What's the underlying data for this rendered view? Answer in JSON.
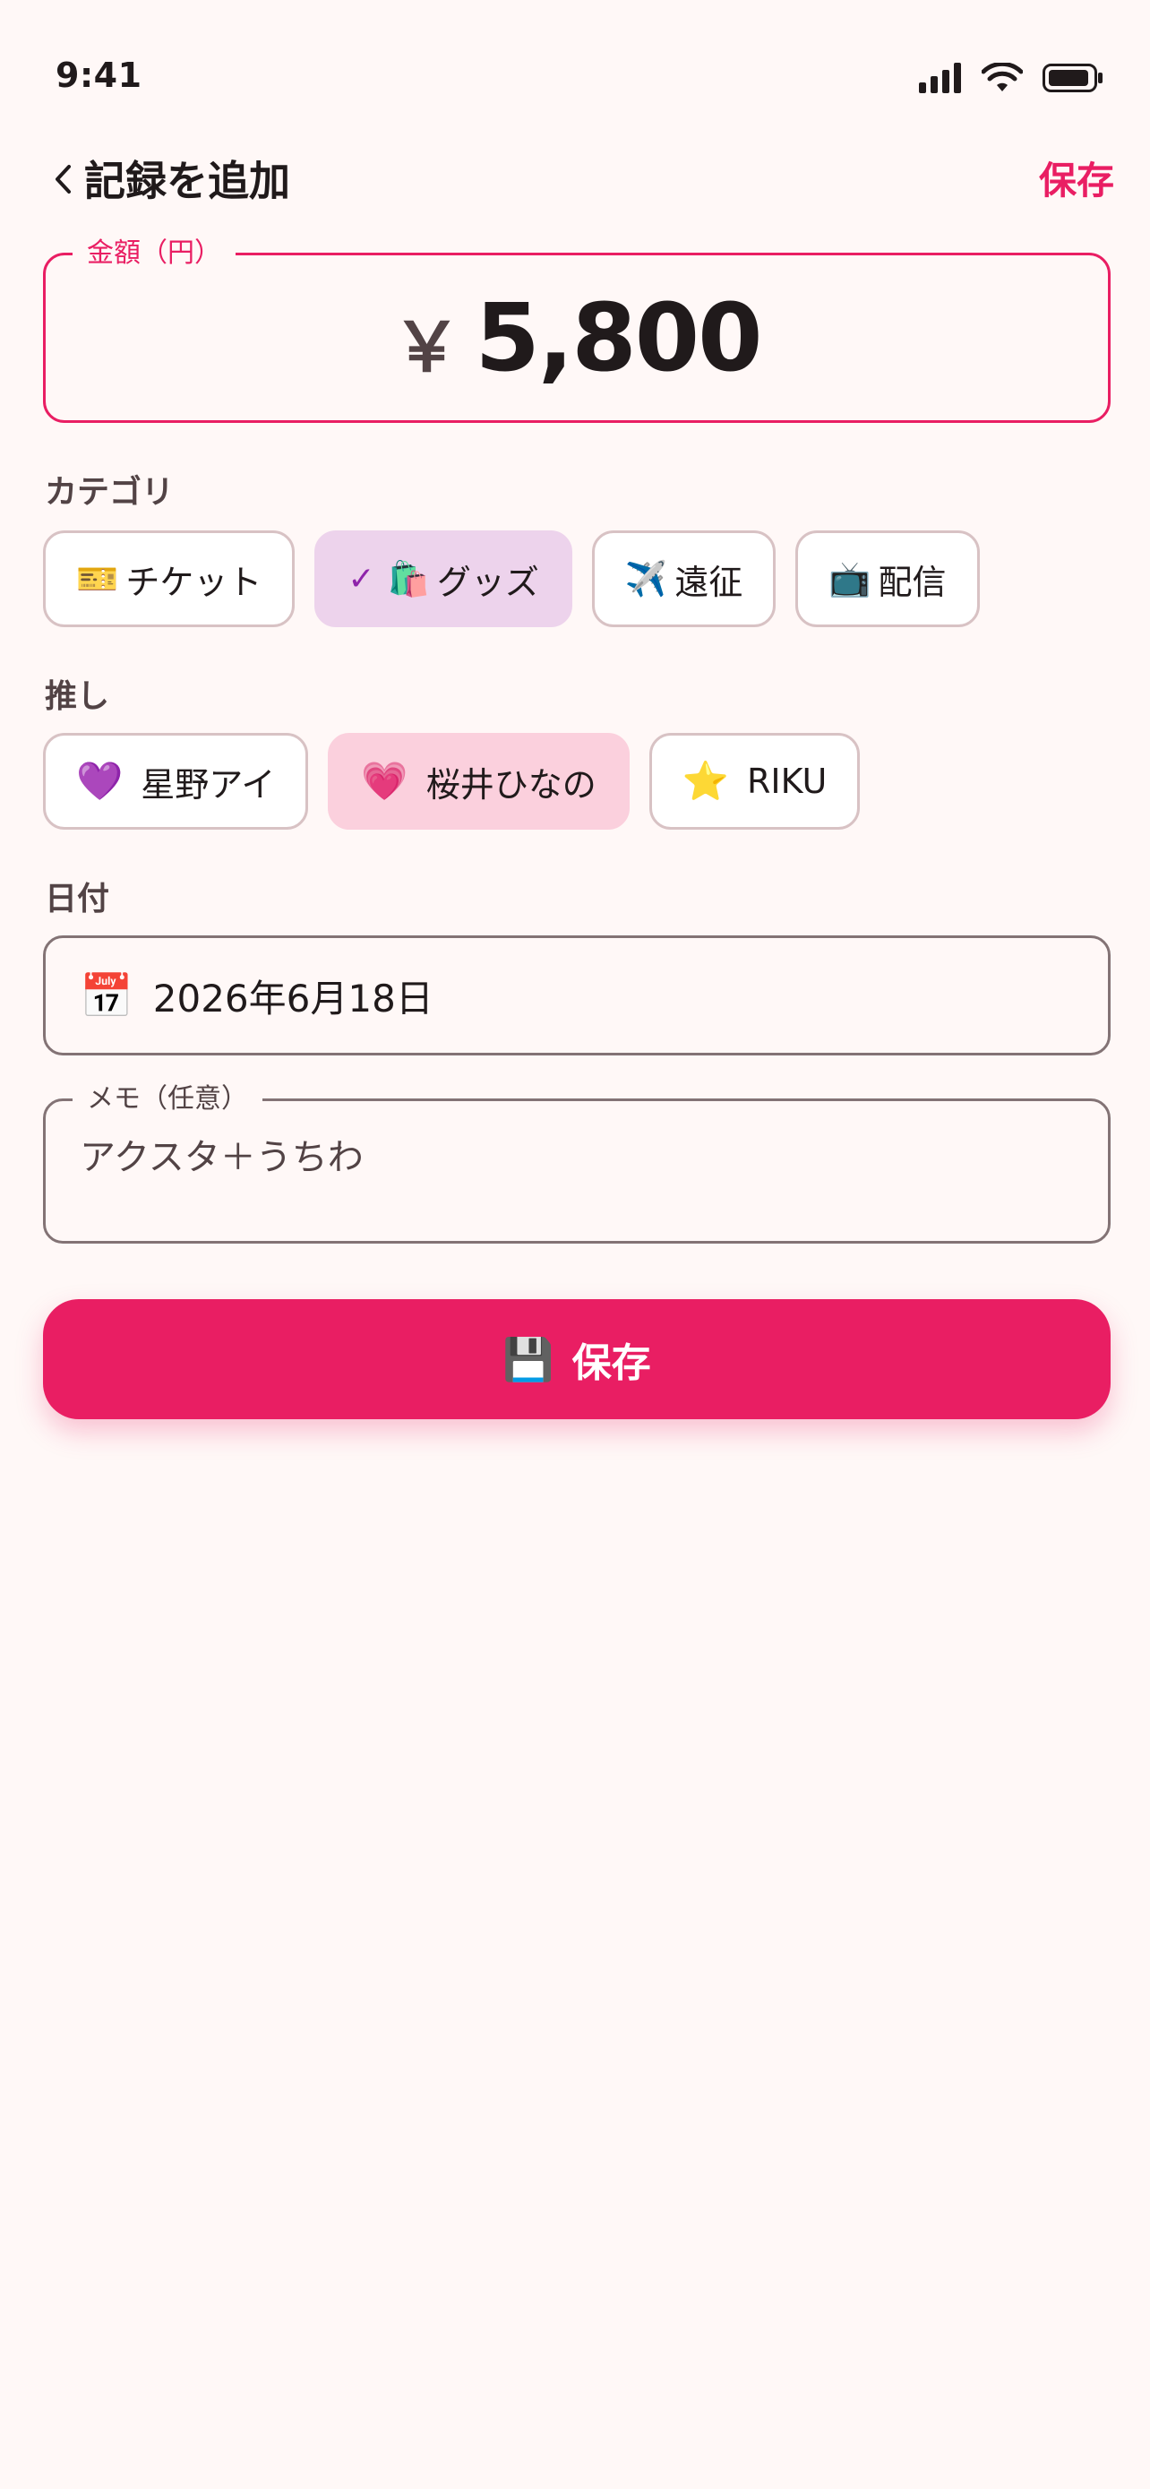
{
  "status_bar": {
    "time": "9:41"
  },
  "app_bar": {
    "title": "記録を追加",
    "save_label": "保存"
  },
  "amount": {
    "label": "金額（円）",
    "currency_symbol": "￥",
    "value": "5,800"
  },
  "category": {
    "label": "カテゴリ",
    "items": [
      {
        "emoji": "🎫",
        "label": "チケット"
      },
      {
        "emoji": "🛍️",
        "label": "グッズ",
        "check": "✓"
      },
      {
        "emoji": "✈️",
        "label": "遠征"
      },
      {
        "emoji": "📺",
        "label": "配信"
      }
    ],
    "selected": "グッズ"
  },
  "oshi": {
    "label": "推し",
    "items": [
      {
        "emoji": "💜",
        "label": "星野アイ"
      },
      {
        "emoji": "💗",
        "label": "桜井ひなの"
      },
      {
        "emoji": "⭐",
        "label": "RIKU"
      }
    ],
    "selected": "桜井ひなの"
  },
  "date": {
    "label": "日付",
    "icon": "📅",
    "value": "2026年6月18日"
  },
  "memo": {
    "label": "メモ（任意）",
    "value": "アクスタ＋うちわ"
  },
  "save_button": {
    "icon": "💾",
    "label": "保存"
  },
  "colors": {
    "accent": "#E91E63",
    "selected_category": "#EDD3EC",
    "selected_oshi": "#FBD0DD",
    "background": "#FFF8F7"
  }
}
